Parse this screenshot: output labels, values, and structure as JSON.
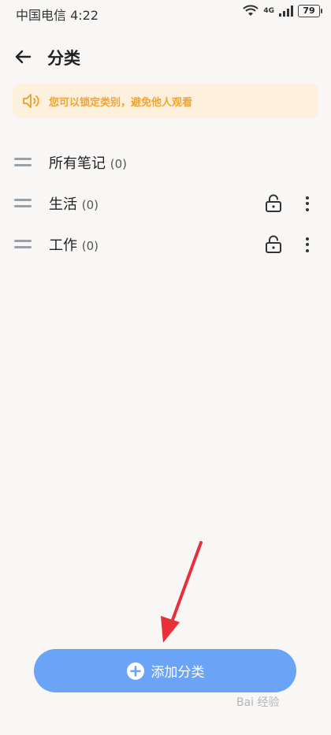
{
  "status_bar": {
    "carrier": "中国电信 4:22",
    "network": "4G",
    "battery": "79"
  },
  "header": {
    "back_icon": "arrow-left-icon",
    "title": "分类"
  },
  "notice": {
    "icon": "speaker-icon",
    "text": "您可以锁定类别，避免他人观看",
    "color": "#f0a436",
    "background": "#fdf0dc"
  },
  "categories": [
    {
      "name": "所有笔记",
      "count": "(0)",
      "lockable": false
    },
    {
      "name": "生活",
      "count": "(0)",
      "lockable": true
    },
    {
      "name": "工作",
      "count": "(0)",
      "lockable": true
    }
  ],
  "add_button": {
    "label": "添加分类",
    "color": "#6ba4f7"
  },
  "annotation": {
    "color": "#e8303a"
  },
  "watermark": {
    "text": "Bai 经验"
  }
}
